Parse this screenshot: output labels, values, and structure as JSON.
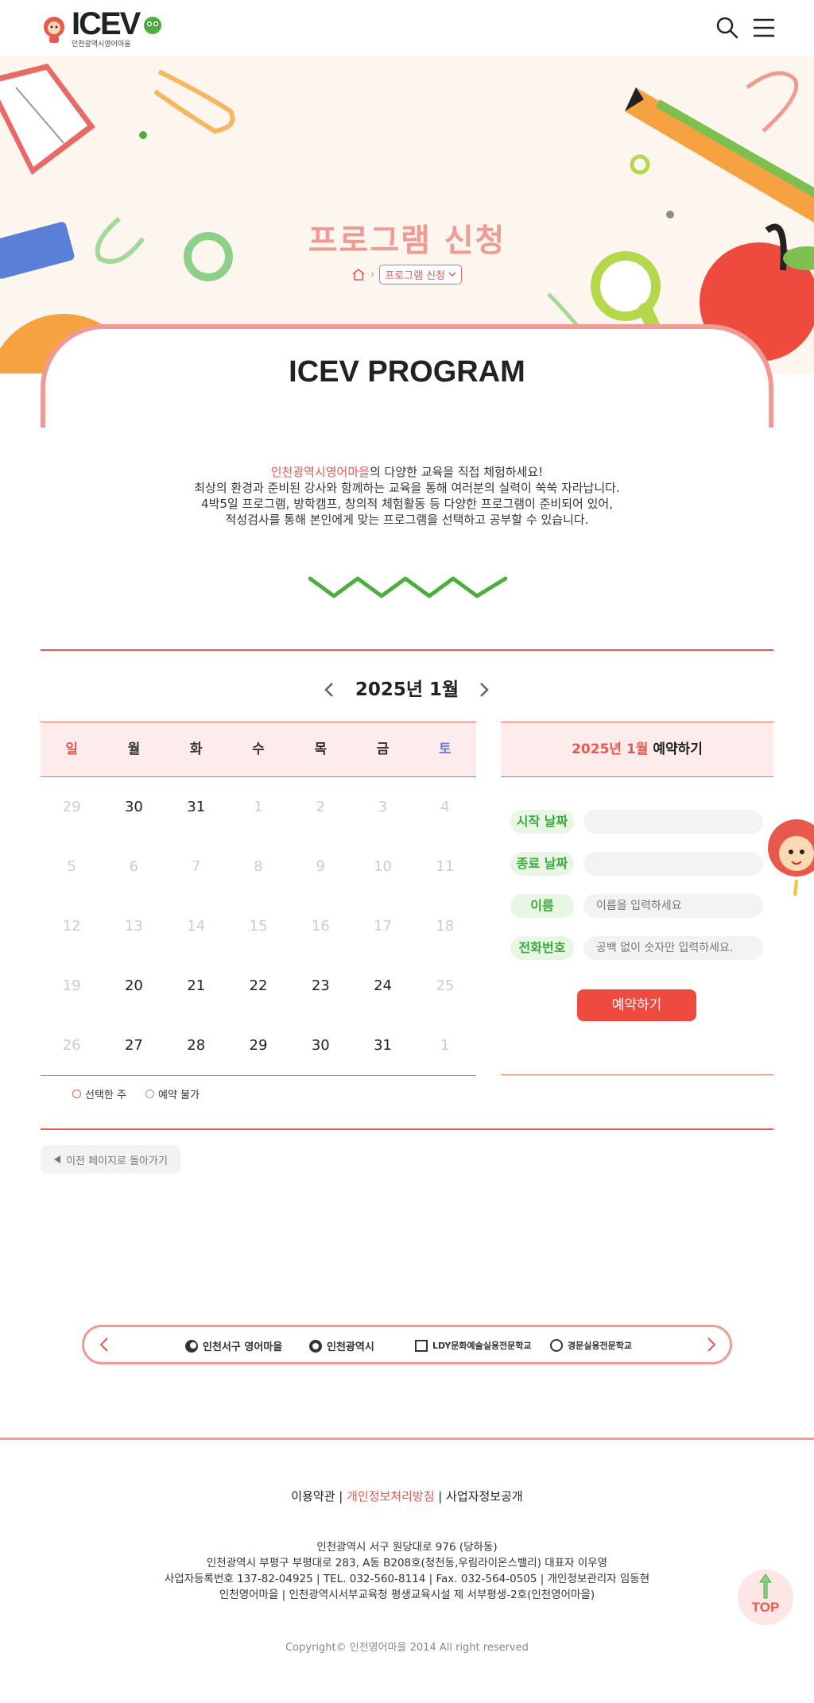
{
  "header": {
    "logo_text": "ICEV",
    "logo_sub": "인천광역시영어마을"
  },
  "hero": {
    "title": "프로그램 신청",
    "breadcrumb_current": "프로그램 신청"
  },
  "program": {
    "title": "ICEV PROGRAM",
    "intro_highlight": "인천광역시영어마을",
    "intro_line1_rest": "의 다양한 교육을 직접 체험하세요!",
    "intro_line2": "최상의 환경과 준비된 강사와 함께하는 교육을 통해 여러분의 실력이 쑥쑥 자라납니다.",
    "intro_line3": "4박5일 프로그램, 방학캠프, 창의적 체험활동 등 다양한 프로그램이 준비되어 있어,",
    "intro_line4": "적성검사를 통해 본인에게 맞는 프로그램을 선택하고 공부할 수 있습니다."
  },
  "calendar": {
    "month_label": "2025년 1월",
    "weekdays": [
      "일",
      "월",
      "화",
      "수",
      "목",
      "금",
      "토"
    ],
    "weekday_colors": [
      "#e9584d",
      "#333333",
      "#333333",
      "#333333",
      "#333333",
      "#333333",
      "#6b7fd7"
    ],
    "weeks": [
      [
        {
          "d": "29",
          "off": true
        },
        {
          "d": "30",
          "off": false
        },
        {
          "d": "31",
          "off": false
        },
        {
          "d": "1",
          "off": true
        },
        {
          "d": "2",
          "off": true
        },
        {
          "d": "3",
          "off": true
        },
        {
          "d": "4",
          "off": true
        }
      ],
      [
        {
          "d": "5",
          "off": true
        },
        {
          "d": "6",
          "off": true
        },
        {
          "d": "7",
          "off": true
        },
        {
          "d": "8",
          "off": true
        },
        {
          "d": "9",
          "off": true
        },
        {
          "d": "10",
          "off": true
        },
        {
          "d": "11",
          "off": true
        }
      ],
      [
        {
          "d": "12",
          "off": true
        },
        {
          "d": "13",
          "off": true
        },
        {
          "d": "14",
          "off": true
        },
        {
          "d": "15",
          "off": true
        },
        {
          "d": "16",
          "off": true
        },
        {
          "d": "17",
          "off": true
        },
        {
          "d": "18",
          "off": true
        }
      ],
      [
        {
          "d": "19",
          "off": true
        },
        {
          "d": "20",
          "off": false
        },
        {
          "d": "21",
          "off": false
        },
        {
          "d": "22",
          "off": false
        },
        {
          "d": "23",
          "off": false
        },
        {
          "d": "24",
          "off": false
        },
        {
          "d": "25",
          "off": true
        }
      ],
      [
        {
          "d": "26",
          "off": true
        },
        {
          "d": "27",
          "off": false
        },
        {
          "d": "28",
          "off": false
        },
        {
          "d": "29",
          "off": false
        },
        {
          "d": "30",
          "off": false
        },
        {
          "d": "31",
          "off": false
        },
        {
          "d": "1",
          "off": true
        }
      ]
    ],
    "legend_selected": "선택한 주",
    "legend_unavailable": "예약 불가"
  },
  "reservation": {
    "heading_highlight": "2025년 1월",
    "heading_rest": " 예약하기",
    "start_label": "시작 날짜",
    "end_label": "종료 날짜",
    "name_label": "이름",
    "name_placeholder": "이름을 입력하세요",
    "phone_label": "전화번호",
    "phone_placeholder": "공백 없이 숫자만 입력하세요.",
    "submit_label": "예약하기"
  },
  "back_button_label": "이전 페이지로 돌아가기",
  "partners": [
    {
      "name": "인천서구 영어마을"
    },
    {
      "name": "인천광역시"
    },
    {
      "name": "LDY문화예술실용전문학교"
    },
    {
      "name": "경문실용전문학교"
    }
  ],
  "footer": {
    "link_terms": "이용약관",
    "link_privacy": "개인정보처리방침",
    "link_business": "사업자정보공개",
    "separator": " | ",
    "info_line1": "인천광역시 서구 원당대로 976 (당하동)",
    "info_line2": "인천광역시 부평구 부평대로 283, A동 B208호(청천동,우림라이온스밸리) 대표자 이우영",
    "info_line3": "사업자등록번호 137-82-04925 | TEL. 032-560-8114 | Fax. 032-564-0505 | 개인정보관리자 임동현",
    "info_line4": "인천영어마을 | 인천광역시서부교육청 평생교육시설 제 서부평생-2호(인천영어마을)",
    "copyright": "Copyright© 인천영어마을 2014 All right reserved",
    "top_label": "TOP"
  },
  "colors": {
    "accent_red": "#e9584d",
    "accent_pink": "#f19a94",
    "accent_green": "#3aab3a",
    "hero_bg": "#fcf6ee"
  }
}
